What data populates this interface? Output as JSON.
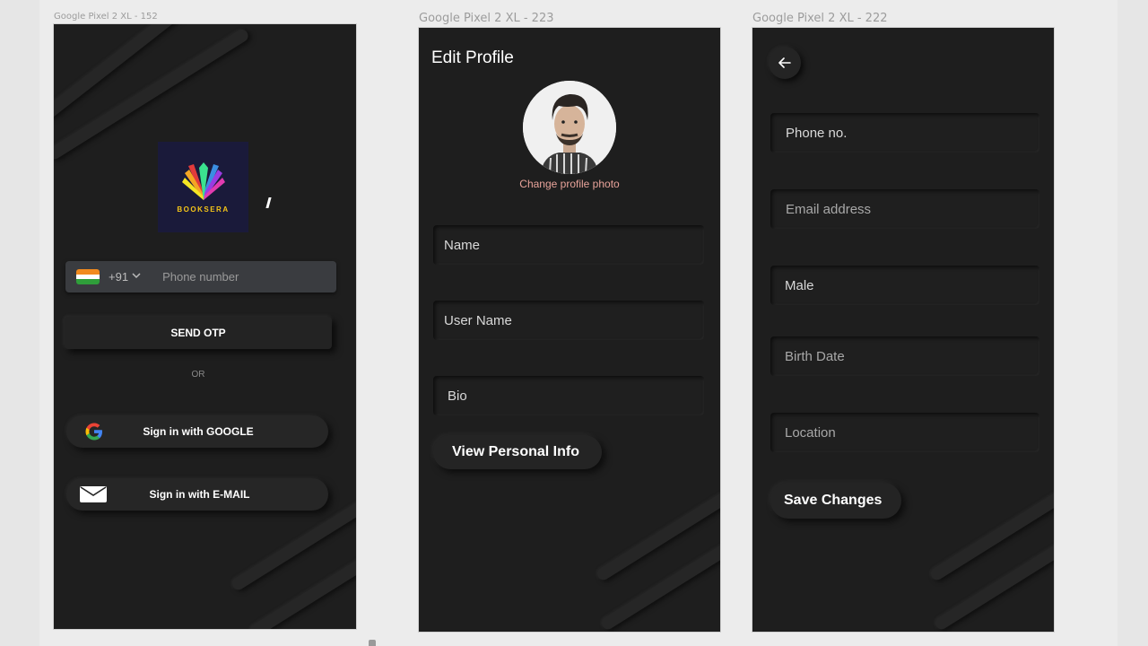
{
  "frames": {
    "login": {
      "label": "Google Pixel 2 XL - 152"
    },
    "edit_profile": {
      "label": "Google Pixel 2 XL - 223"
    },
    "personal_info": {
      "label": "Google Pixel 2 XL - 222"
    }
  },
  "login": {
    "logo_text": "BOOKSERA",
    "country_code": "+91",
    "phone_placeholder": "Phone number",
    "send_otp_label": "SEND OTP",
    "or_label": "OR",
    "google_label": "Sign in with GOOGLE",
    "email_label": "Sign in with E-MAIL"
  },
  "edit_profile": {
    "title": "Edit Profile",
    "change_photo_label": "Change profile photo",
    "fields": {
      "name": "Name",
      "username": "User Name",
      "bio": "Bio"
    },
    "view_info_label": "View Personal Info"
  },
  "personal_info": {
    "fields": {
      "phone": "Phone no.",
      "email": "Email address",
      "gender": "Male",
      "birth_date": "Birth Date",
      "location": "Location"
    },
    "save_label": "Save Changes"
  },
  "colors": {
    "screen_bg": "#1e1e1e",
    "accent_link": "#e8a39a",
    "logo_bg": "#1a1a3a"
  }
}
